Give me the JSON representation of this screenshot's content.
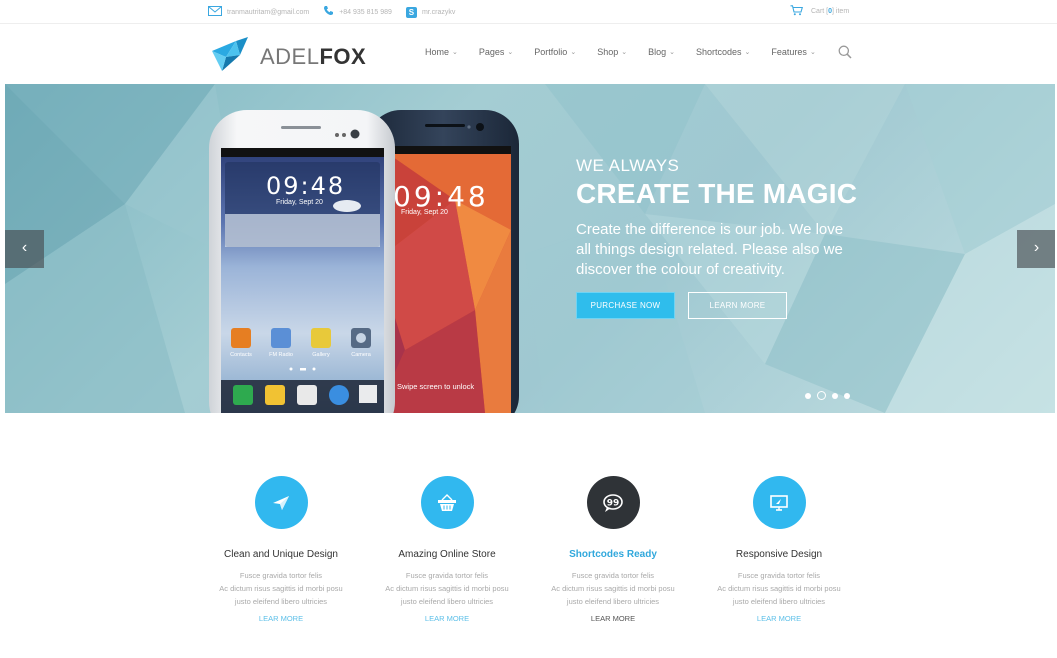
{
  "topbar": {
    "email": "tranmautritam@gmail.com",
    "phone": "+84 935 815 989",
    "skype": "mr.crazykv",
    "cart_prefix": "Cart [",
    "cart_count": "0",
    "cart_suffix": "] item"
  },
  "header": {
    "logo_light": "ADEL",
    "logo_bold": "FOX",
    "nav": [
      "Home",
      "Pages",
      "Portfolio",
      "Shop",
      "Blog",
      "Shortcodes",
      "Features"
    ]
  },
  "hero": {
    "subtitle": "WE ALWAYS",
    "title": "CREATE THE MAGIC",
    "description": "Create the difference is our job. We love all things design related. Please also we discover the colour of creativity.",
    "purchase_label": "PURCHASE NOW",
    "learn_label": "LEARN MORE",
    "prev_arrow": "‹",
    "next_arrow": "›",
    "slide_count": 4,
    "active_slide": 2,
    "phone_front": {
      "time": "09:48",
      "date": "Friday, Sept 20",
      "apps": [
        "Contacts",
        "FM Radio",
        "Gallery",
        "Camera"
      ]
    },
    "phone_back": {
      "time": "09:48",
      "date": "Friday, Sept 20",
      "unlock": "Swipe screen to unlock"
    }
  },
  "features": [
    {
      "icon": "paper-plane-icon",
      "title": "Clean and Unique Design",
      "line1": "Fusce gravida tortor felis",
      "line2": "Ac dictum risus sagittis id morbi posu",
      "line3": "justo eleifend libero ultricies",
      "link": "LEAR MORE"
    },
    {
      "icon": "basket-icon",
      "title": "Amazing Online Store",
      "line1": "Fusce gravida tortor felis",
      "line2": "Ac dictum risus sagittis id morbi posu",
      "line3": "justo eleifend libero ultricies",
      "link": "LEAR MORE"
    },
    {
      "icon": "quote-bubble-icon",
      "title": "Shortcodes Ready",
      "line1": "Fusce gravida tortor felis",
      "line2": "Ac dictum risus sagittis id morbi posu",
      "line3": "justo eleifend libero ultricies",
      "link": "LEAR MORE"
    },
    {
      "icon": "monitor-icon",
      "title": "Responsive Design",
      "line1": "Fusce gravida tortor felis",
      "line2": "Ac dictum risus sagittis id morbi posu",
      "line3": "justo eleifend libero ultricies",
      "link": "LEAR MORE"
    }
  ],
  "colors": {
    "accent": "#31b8ef",
    "dark": "#2f3337"
  }
}
